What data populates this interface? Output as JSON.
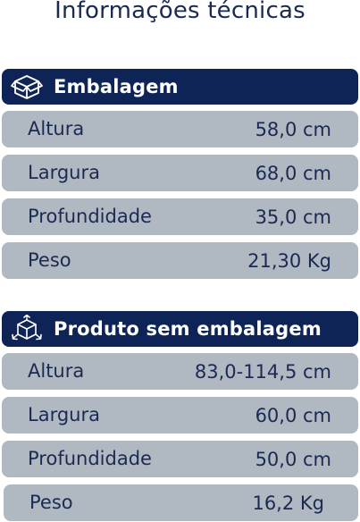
{
  "title": "Informações técnicas",
  "sections": [
    {
      "header": "Embalagem",
      "icon": "box-icon",
      "rows": [
        {
          "name": "Altura",
          "value": "58,0 cm"
        },
        {
          "name": "Largura",
          "value": "68,0 cm"
        },
        {
          "name": "Profundidade",
          "value": "35,0 cm"
        },
        {
          "name": "Peso",
          "value": "21,30 Kg"
        }
      ]
    },
    {
      "header": "Produto sem embalagem",
      "icon": "3d-cube-icon",
      "rows": [
        {
          "name": "Altura",
          "value": "83,0-114,5 cm"
        },
        {
          "name": "Largura",
          "value": "60,0 cm"
        },
        {
          "name": "Profundidade",
          "value": "50,0 cm"
        },
        {
          "name": "Peso",
          "value": "16,2 Kg"
        }
      ]
    }
  ],
  "colors": {
    "header_bg": "#0e2456",
    "row_bg": "#b0b8c2",
    "text": "#1b2a52"
  }
}
